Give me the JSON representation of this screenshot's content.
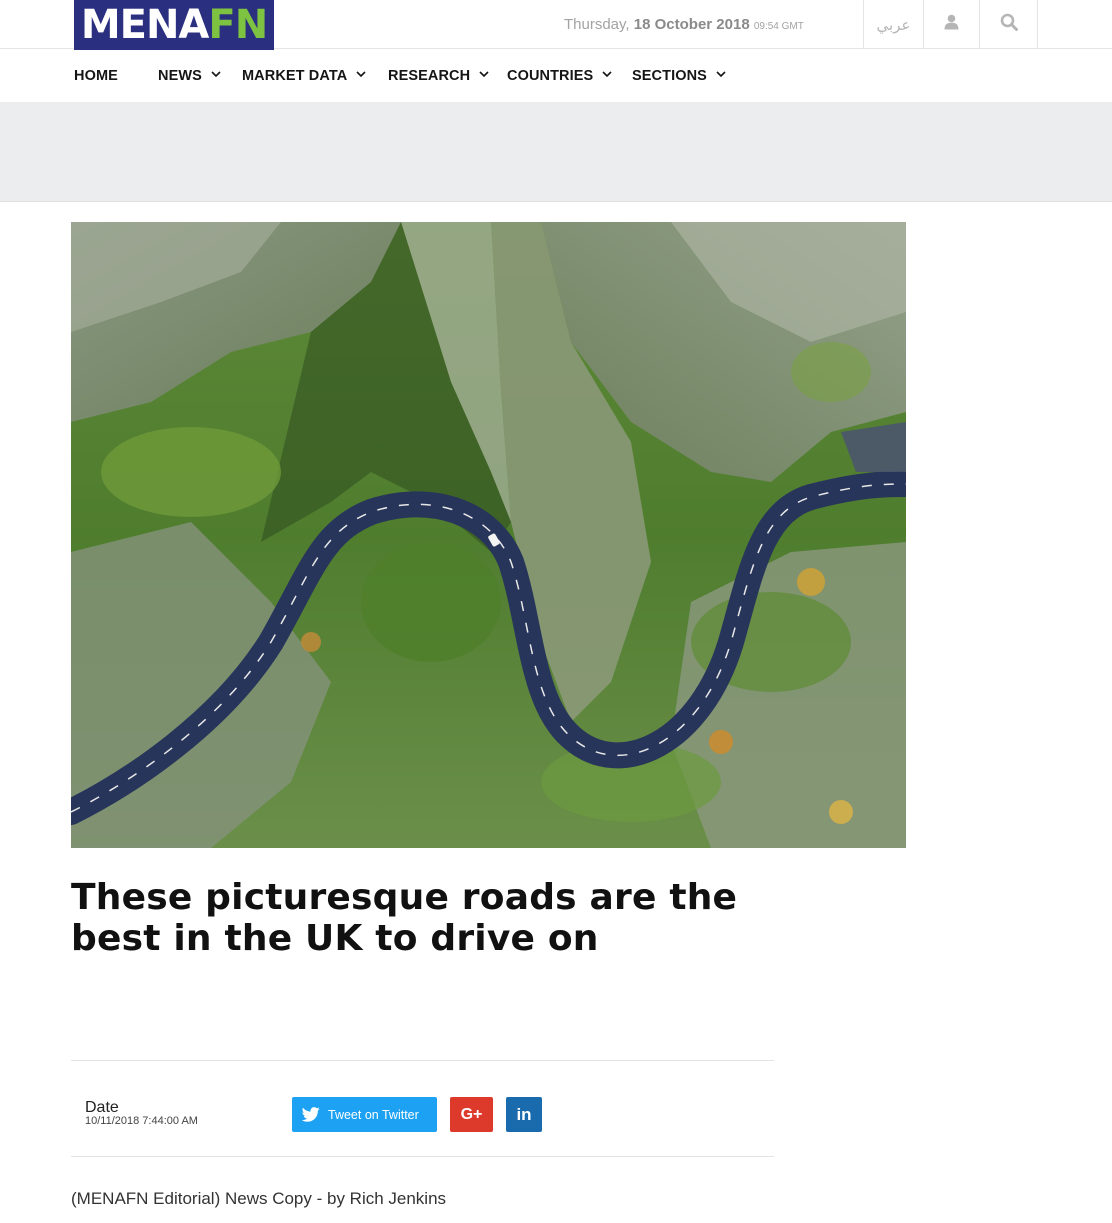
{
  "header": {
    "logo": {
      "mena": "MENA",
      "fn": "FN"
    },
    "date": {
      "day": "Thursday,",
      "date": "18 October 2018",
      "time": "09:54 GMT"
    },
    "arabic_label": "عربي",
    "icons": {
      "user": "user-icon",
      "search": "search-icon"
    }
  },
  "nav": {
    "items": [
      {
        "label": "HOME",
        "has_dropdown": false
      },
      {
        "label": "NEWS",
        "has_dropdown": true
      },
      {
        "label": "MARKET DATA",
        "has_dropdown": true
      },
      {
        "label": "RESEARCH",
        "has_dropdown": true
      },
      {
        "label": "COUNTRIES",
        "has_dropdown": true
      },
      {
        "label": "SECTIONS",
        "has_dropdown": true
      }
    ]
  },
  "article": {
    "title": "These picturesque roads are the best in the UK to drive on",
    "date_label": "Date",
    "date_value": "10/11/2018 7:44:00 AM",
    "share": {
      "twitter_label": "Tweet on Twitter",
      "gplus_label": "G+",
      "linkedin_label": "in"
    },
    "byline": "(MENAFN Editorial) News Copy - by Rich Jenkins"
  },
  "colors": {
    "brand_navy": "#2b2f7f",
    "brand_green": "#7ec242",
    "twitter": "#1da1f2",
    "gplus": "#dd3a2c",
    "linkedin": "#1a6bad"
  }
}
